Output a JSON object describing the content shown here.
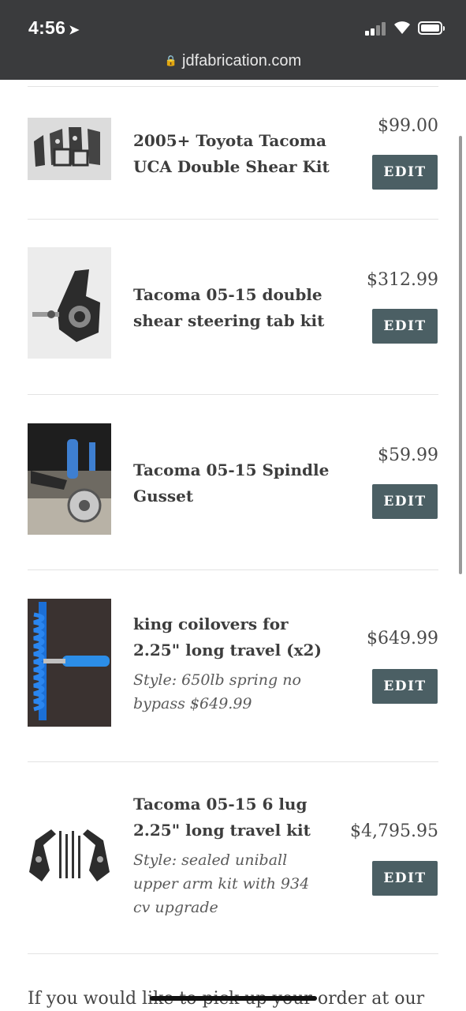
{
  "status_bar": {
    "time": "4:56",
    "url": "jdfabrication.com"
  },
  "cart": {
    "items": [
      {
        "title": "2005+ Toyota Tacoma UCA Double Shear Kit",
        "style": "",
        "price": "$99.00",
        "edit_label": "EDIT",
        "image_icon": "bracket-kit-photo"
      },
      {
        "title": "Tacoma 05-15 double shear steering tab kit",
        "style": "",
        "price": "$312.99",
        "edit_label": "EDIT",
        "image_icon": "steering-knuckle-photo"
      },
      {
        "title": "Tacoma 05-15 Spindle Gusset",
        "style": "",
        "price": "$59.99",
        "edit_label": "EDIT",
        "image_icon": "spindle-photo"
      },
      {
        "title": "king coilovers for 2.25\" long travel (x2)",
        "style": "Style: 650lb spring no bypass $649.99",
        "price": "$649.99",
        "edit_label": "EDIT",
        "image_icon": "coilover-photo"
      },
      {
        "title": "Tacoma 05-15 6 lug 2.25\" long travel kit",
        "style": "Style: sealed uniball upper arm kit with 934 cv upgrade",
        "price": "$4,795.95",
        "edit_label": "EDIT",
        "image_icon": "long-travel-kit-photo"
      }
    ]
  },
  "footer": {
    "text": "If you would like to pick up your order at our"
  },
  "colors": {
    "status_bg": "#3a3b3d",
    "button_bg": "#4b5f64"
  }
}
